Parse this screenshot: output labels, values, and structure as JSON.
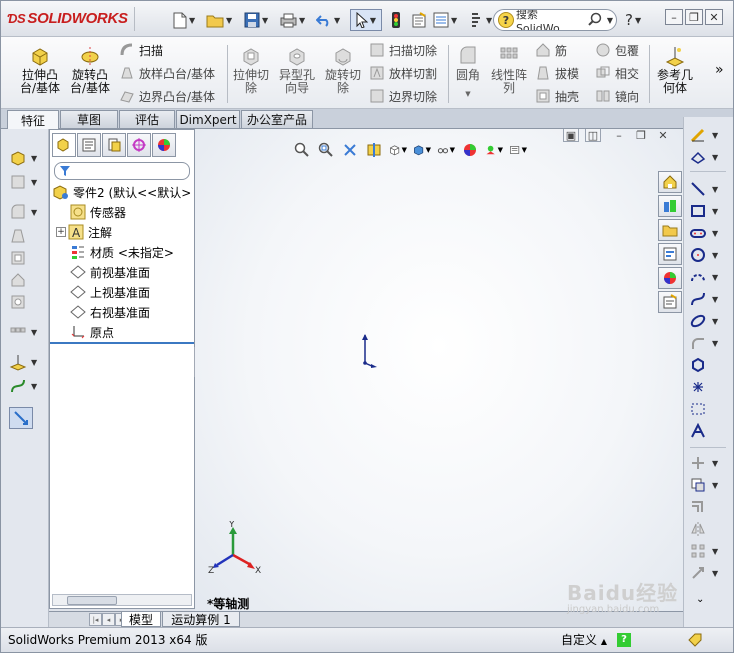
{
  "app": {
    "brand": "SOLIDWORKS",
    "brand_color": "#c81e1e"
  },
  "titlebar": {
    "search_text": "搜索 SolidWo",
    "help_icon": "question-icon",
    "icons": [
      "new-document-icon",
      "open-folder-icon",
      "save-icon",
      "print-icon",
      "undo-icon",
      "select-cursor-icon",
      "traffic-light-icon",
      "file-properties-icon",
      "options-icon",
      "tools-icon"
    ]
  },
  "ribbon": {
    "extrude_boss": "拉伸凸台/基体",
    "revolve_boss": "旋转凸台/基体",
    "sweep": "扫描",
    "loft_boss": "放样凸台/基体",
    "boundary_boss": "边界凸台/基体",
    "extrude_cut": "拉伸切除",
    "hole_wizard": "异型孔向导",
    "revolve_cut": "旋转切除",
    "swept_cut": "扫描切除",
    "lofted_cut": "放样切割",
    "boundary_cut": "边界切除",
    "fillet": "圆角",
    "linear_pattern": "线性阵列",
    "rib": "筋",
    "draft": "拔模",
    "shell": "抽壳",
    "wrap": "包覆",
    "intersect": "相交",
    "mirror": "镜向",
    "ref_geometry": "参考几何体",
    "more": "»"
  },
  "tabs": [
    {
      "label": "特征",
      "active": true
    },
    {
      "label": "草图",
      "active": false
    },
    {
      "label": "评估",
      "active": false
    },
    {
      "label": "DimXpert",
      "active": false
    },
    {
      "label": "办公室产品",
      "active": false
    }
  ],
  "tree": {
    "part": "零件2 (默认<<默认>",
    "items": [
      {
        "label": "传感器",
        "icon": "sensor-icon"
      },
      {
        "label": "注解",
        "icon": "annotation-icon",
        "expandable": true
      },
      {
        "label": "材质 <未指定>",
        "icon": "material-icon"
      },
      {
        "label": "前视基准面",
        "icon": "plane-icon"
      },
      {
        "label": "上视基准面",
        "icon": "plane-icon"
      },
      {
        "label": "右视基准面",
        "icon": "plane-icon"
      },
      {
        "label": "原点",
        "icon": "origin-icon"
      }
    ]
  },
  "viewport": {
    "view_label": "*等轴测",
    "triad_x": "X",
    "triad_y": "Y",
    "triad_z": "Z"
  },
  "bottom_tabs": [
    {
      "label": "模型",
      "active": true
    },
    {
      "label": "运动算例 1",
      "active": false
    }
  ],
  "status": {
    "text": "SolidWorks Premium 2013 x64 版",
    "custom": "自定义",
    "custom_arrow": "▲"
  },
  "watermark": {
    "text": "Baidu经验",
    "sub": "jingyan.baidu.com"
  }
}
